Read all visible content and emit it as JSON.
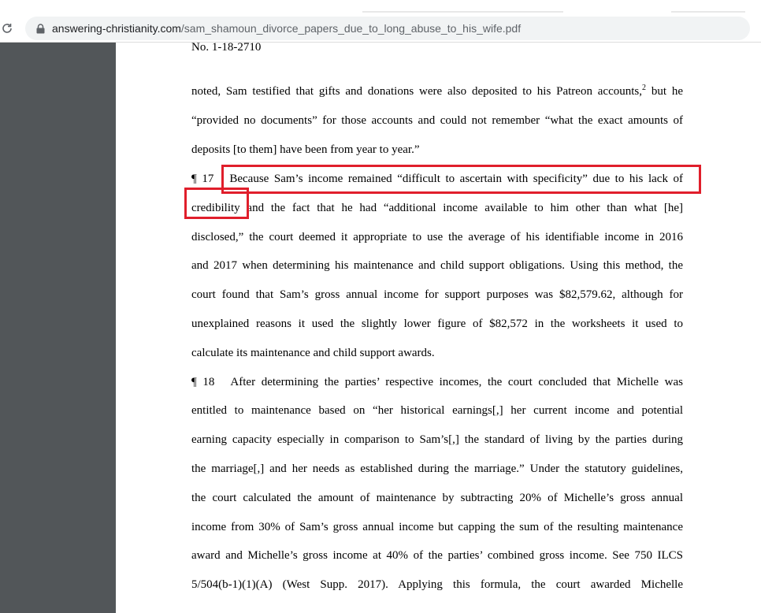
{
  "browser": {
    "url_host": "answering-christianity.com",
    "url_path": "/sam_shamoun_divorce_papers_due_to_long_abuse_to_his_wife.pdf"
  },
  "document": {
    "case_number": "No. 1-18-2710",
    "lines": [
      "noted, Sam testified that gifts and donations were also deposited to his Patreon accounts,",
      "“provided no documents” for those accounts and could not remember “what the exact amounts of",
      "deposits [to them] have been from year to year.”",
      "Because Sam’s income remained “difficult to ascertain with specificity” due to his lack of",
      "credibility and the fact that he had “additional income available to him other than what [he]",
      "disclosed,” the court deemed it appropriate to use the average of his identifiable income in 2016",
      "and 2017 when determining his maintenance and child support obligations. Using this method, the",
      "court found that Sam’s gross annual income for support purposes was $82,579.62, although for",
      "unexplained reasons it used the slightly lower figure of $82,572 in the worksheets it used to",
      "calculate its maintenance and child support awards.",
      "After determining the parties’ respective incomes, the court concluded that Michelle was",
      "entitled to maintenance based on “her historical earnings[,] her current income and potential",
      "earning capacity especially in comparison to Sam’s[,] the standard of living by the parties during",
      "the marriage[,] and her needs as established during the marriage.” Under the statutory guidelines,",
      "the court calculated the amount of maintenance by subtracting 20% of Michelle’s gross annual",
      "income from 30% of Sam’s gross annual income but capping the sum of the resulting maintenance",
      "award and Michelle’s gross income at 40% of the parties’ combined gross income. See 750 ILCS",
      "5/504(b-1)(1)(A) (West Supp. 2017). Applying this formula, the court awarded Michelle"
    ],
    "footnote_ref": "2",
    "line0_tail": " but he",
    "para17_mark": "¶ 17",
    "para18_mark": "¶ 18"
  },
  "colors": {
    "highlight": "#e01e2b",
    "sidebar": "#525659"
  }
}
